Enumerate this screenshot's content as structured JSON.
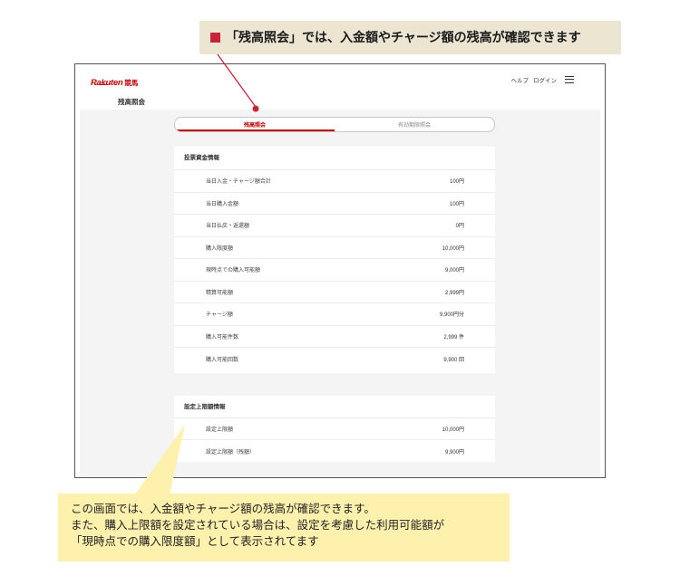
{
  "callout": {
    "text": "「残高照会」では、入金額やチャージ額の残高が確認できます"
  },
  "screen": {
    "header": {
      "logo_brand": "Rakuten",
      "logo_service": "競馬",
      "help_label": "ヘルプ",
      "login_label": "ログイン",
      "menu_icon": "hamburger-icon"
    },
    "page_title": "残高照会",
    "tabs": [
      {
        "label": "残高照会",
        "active": true
      },
      {
        "label": "有効期限照会",
        "active": false
      }
    ],
    "sections": [
      {
        "title": "投票資金情報",
        "rows": [
          {
            "label": "当日入金・チャージ額合計",
            "value": "100円"
          },
          {
            "label": "当日購入金額",
            "value": "100円"
          },
          {
            "label": "当日払戻・返還額",
            "value": "0円"
          },
          {
            "label": "購入限度額",
            "value": "10,000円"
          },
          {
            "label": "現時点での購入可能額",
            "value": "9,000円"
          },
          {
            "label": "精算可能額",
            "value": "2,999円"
          },
          {
            "label": "チャージ額",
            "value": "9,900円分"
          },
          {
            "label": "購入可能件数",
            "value": "2,999 件"
          },
          {
            "label": "購入可能回数",
            "value": "9,900 回"
          }
        ]
      },
      {
        "title": "設定上限額情報",
        "rows": [
          {
            "label": "設定上限額",
            "value": "10,000円"
          },
          {
            "label": "設定上限額（残額）",
            "value": "9,900円"
          }
        ]
      }
    ]
  },
  "note": {
    "lines": [
      "この画面では、入金額やチャージ額の残高が確認できます。",
      "また、購入上限額を設定されている場合は、設定を考慮した利用可能額が",
      "「現時点での購入限度額」として表示されてます"
    ]
  },
  "colors": {
    "accent_red": "#bf0000",
    "marker_red": "#c7243a",
    "callout_bg": "#ece5d2",
    "note_bg": "#fdf1ad",
    "content_bg": "#f4f4f4",
    "frame_border": "#555555"
  }
}
